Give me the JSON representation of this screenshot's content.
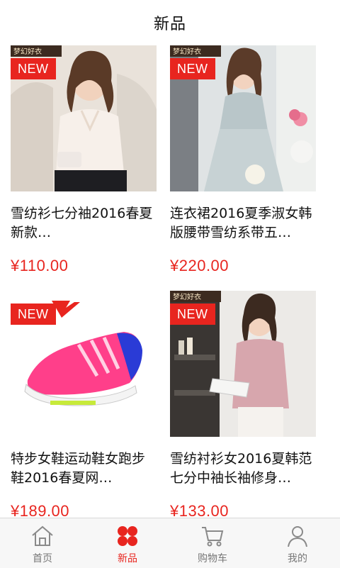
{
  "header": {
    "title": "新品"
  },
  "badge_text": "NEW",
  "colors": {
    "accent": "#e8251f",
    "text": "#111111",
    "tab_inactive": "#777777"
  },
  "products": [
    {
      "name": "雪纺衫七分袖2016春夏新款…",
      "price": "¥110.00",
      "image": "white-chiffon-blouse-photo",
      "brand_mark": "梦幻好衣"
    },
    {
      "name": "连衣裙2016夏季淑女韩版腰带雪纺系带五…",
      "price": "¥220.00",
      "image": "grey-chiffon-dress-photo",
      "brand_mark": "梦幻好衣"
    },
    {
      "name": "特步女鞋运动鞋女跑步鞋2016春夏网…",
      "price": "¥189.00",
      "image": "pink-running-shoe-photo"
    },
    {
      "name": "雪纺衬衫女2016夏韩范七分中袖长袖修身…",
      "price": "¥133.00",
      "image": "pink-blouse-photo",
      "brand_mark": "梦幻好衣"
    }
  ],
  "tabbar": {
    "items": [
      {
        "label": "首页",
        "icon": "home-icon",
        "active": false
      },
      {
        "label": "新品",
        "icon": "new-icon",
        "active": true
      },
      {
        "label": "购物车",
        "icon": "cart-icon",
        "active": false
      },
      {
        "label": "我的",
        "icon": "user-icon",
        "active": false
      }
    ]
  }
}
